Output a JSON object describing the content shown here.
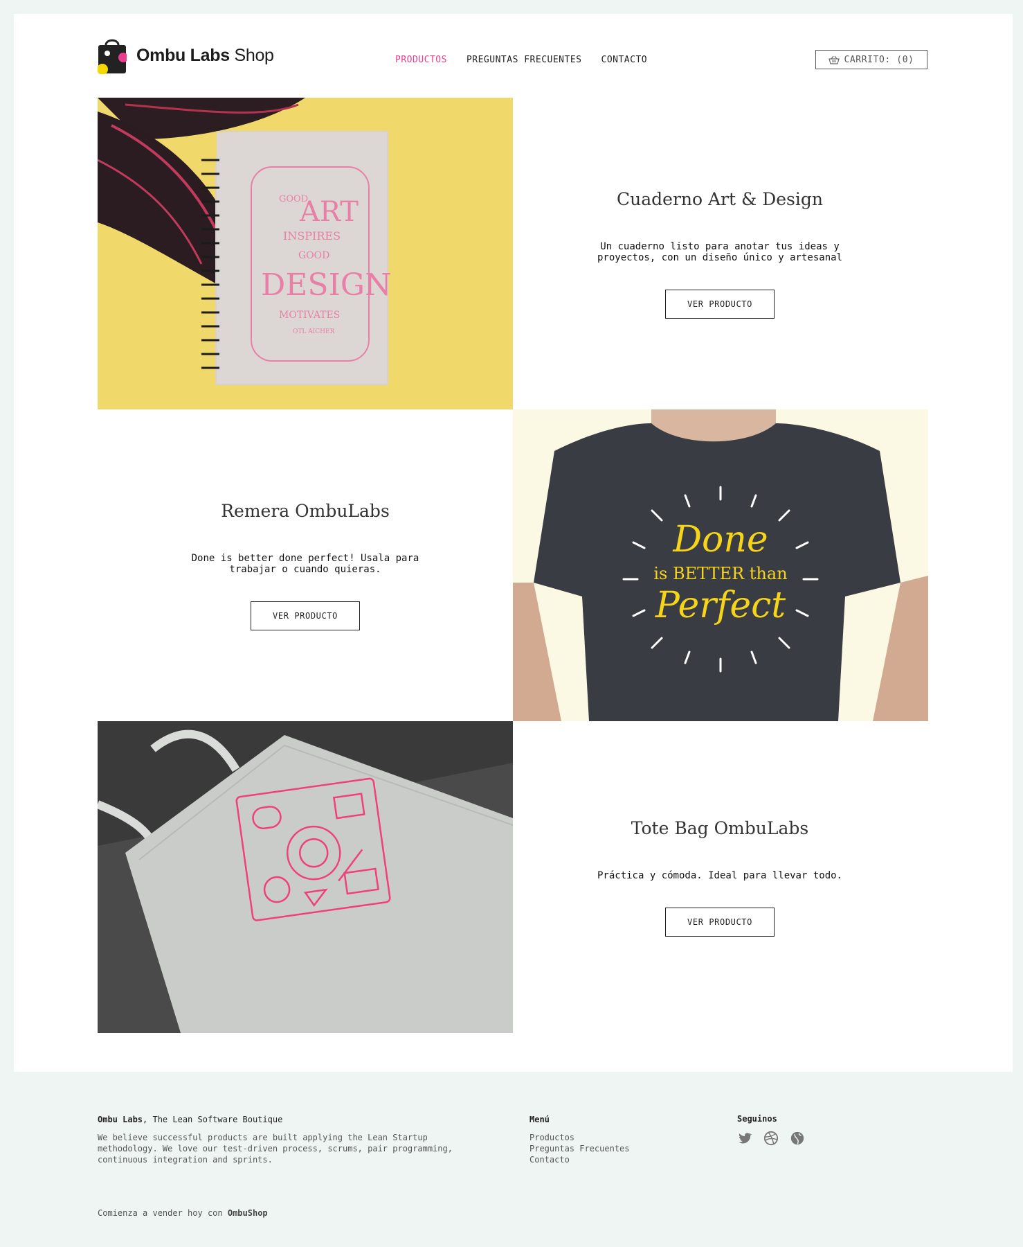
{
  "brand": {
    "name_bold": "Ombu Labs",
    "name_light": "Shop"
  },
  "nav": {
    "items": [
      {
        "label": "PRODUCTOS",
        "active": true
      },
      {
        "label": "PREGUNTAS FRECUENTES",
        "active": false
      },
      {
        "label": "CONTACTO",
        "active": false
      }
    ]
  },
  "cart": {
    "label": "CARRITO: (0)",
    "icon": "basket-icon"
  },
  "products": [
    {
      "title": "Cuaderno Art & Design",
      "description": "Un cuaderno listo para anotar tus ideas y proyectos, con un diseño único y artesanal",
      "button": "VER PRODUCTO"
    },
    {
      "title": "Remera OmbuLabs",
      "description": "Done is better done perfect! Usala para trabajar o cuando quieras.",
      "button": "VER PRODUCTO"
    },
    {
      "title": "Tote Bag OmbuLabs",
      "description": "Práctica y cómoda. Ideal para llevar todo.",
      "button": "VER PRODUCTO"
    }
  ],
  "images": {
    "notebook": {
      "lines": [
        "GOOD",
        "ART",
        "INSPIRES",
        "GOOD",
        "DESIGN",
        "MOTIVATES",
        "OTL AICHER"
      ]
    },
    "tshirt": {
      "lines": [
        "Done",
        "is BETTER than",
        "Perfect"
      ]
    }
  },
  "footer": {
    "company": "Ombu Labs",
    "tagline": ", The Lean Software Boutique",
    "about": "We believe successful products are built applying the Lean Startup methodology. We love our test-driven process, scrums, pair programming, continuous integration and sprints.",
    "menu_title": "Menú",
    "menu": [
      "Productos",
      "Preguntas Frecuentes",
      "Contacto"
    ],
    "social_title": "Seguinos",
    "social": [
      "twitter-icon",
      "dribbble-icon",
      "globe-icon"
    ],
    "bottom_prefix": "Comienza a vender hoy con ",
    "bottom_brand": "OmbuShop"
  },
  "colors": {
    "accent": "#e83e8c",
    "background": "#eef5f3",
    "text": "#222222"
  }
}
